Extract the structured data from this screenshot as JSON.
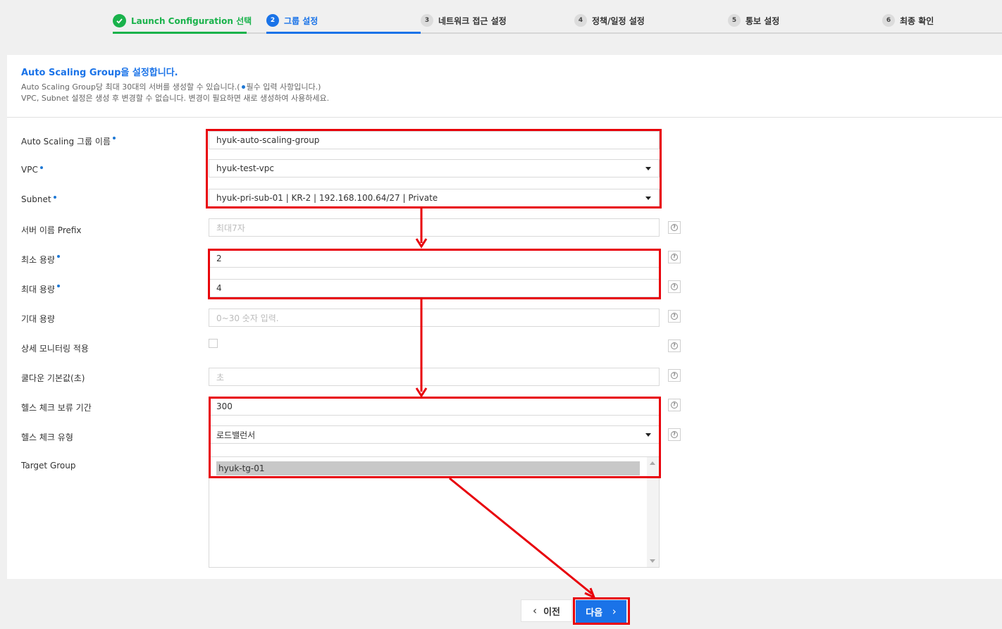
{
  "wizard": {
    "steps": [
      {
        "number": "",
        "label": "Launch Configuration 선택",
        "status": "done"
      },
      {
        "number": "2",
        "label": "그룹 설정",
        "status": "current"
      },
      {
        "number": "3",
        "label": "네트워크 접근 설정",
        "status": "pending"
      },
      {
        "number": "4",
        "label": "정책/일정 설정",
        "status": "pending"
      },
      {
        "number": "5",
        "label": "통보 설정",
        "status": "pending"
      },
      {
        "number": "6",
        "label": "최종 확인",
        "status": "pending"
      }
    ]
  },
  "intro": {
    "title": "Auto Scaling Group을 설정합니다.",
    "line1_prefix": "Auto Scaling Group당 최대 30대의 서버를 생성할 수 있습니다.(",
    "line1_suffix": "필수 입력 사항입니다.)",
    "line2": "VPC, Subnet 설정은 생성 후 변경할 수 없습니다. 변경이 필요하면 새로 생성하여 사용하세요."
  },
  "form": {
    "group_name": {
      "label": "Auto Scaling 그룹 이름",
      "value": "hyuk-auto-scaling-group"
    },
    "vpc": {
      "label": "VPC",
      "value": "hyuk-test-vpc"
    },
    "subnet": {
      "label": "Subnet",
      "value": "hyuk-pri-sub-01 | KR-2 | 192.168.100.64/27 | Private"
    },
    "server_prefix": {
      "label": "서버 이름 Prefix",
      "placeholder": "최대7자"
    },
    "min_capacity": {
      "label": "최소 용량",
      "value": "2"
    },
    "max_capacity": {
      "label": "최대 용량",
      "value": "4"
    },
    "desired_capacity": {
      "label": "기대 용량",
      "placeholder": "0~30 숫자 입력."
    },
    "detailed_monitoring": {
      "label": "상세 모니터링 적용",
      "checked": false
    },
    "cooldown": {
      "label": "쿨다운 기본값(초)",
      "placeholder": "초"
    },
    "health_grace": {
      "label": "헬스 체크 보류 기간",
      "value": "300"
    },
    "health_type": {
      "label": "헬스 체크 유형",
      "value": "로드밸런서"
    },
    "target_group": {
      "label": "Target Group",
      "options": [
        "hyuk-tg-01"
      ],
      "selected": "hyuk-tg-01"
    }
  },
  "buttons": {
    "prev": "이전",
    "next": "다음"
  },
  "colors": {
    "accent": "#1a73e8",
    "done": "#19b24b",
    "highlight": "#e8000a"
  }
}
